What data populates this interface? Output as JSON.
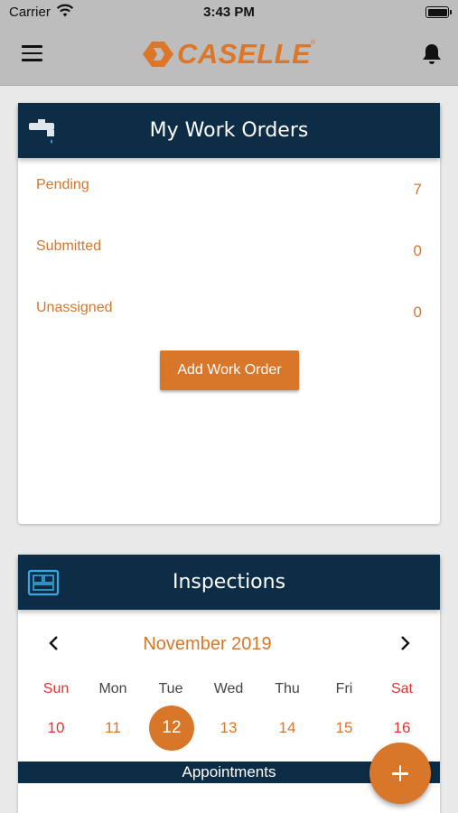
{
  "status_bar": {
    "carrier": "Carrier",
    "time": "3:43 PM"
  },
  "header": {
    "logo_text": "CASELLE",
    "logo_mark": "®",
    "menu_icon": "hamburger-menu-icon",
    "notification_icon": "bell-icon"
  },
  "work_orders": {
    "title": "My Work Orders",
    "icon": "faucet-icon",
    "rows": [
      {
        "label": "Pending",
        "count": "7"
      },
      {
        "label": "Submitted",
        "count": "0"
      },
      {
        "label": "Unassigned",
        "count": "0"
      }
    ],
    "add_button": "Add Work Order"
  },
  "inspections": {
    "title": "Inspections",
    "icon": "blueprint-icon",
    "month": "November 2019",
    "weekdays": [
      "Sun",
      "Mon",
      "Tue",
      "Wed",
      "Thu",
      "Fri",
      "Sat"
    ],
    "days": [
      "10",
      "11",
      "12",
      "13",
      "14",
      "15",
      "16"
    ],
    "selected_day": "12",
    "appointments_label": "Appointments"
  },
  "colors": {
    "accent": "#d8762a",
    "header_bg": "#0d2d47",
    "weekend": "#e03434"
  },
  "fab": {
    "icon": "plus-icon"
  }
}
